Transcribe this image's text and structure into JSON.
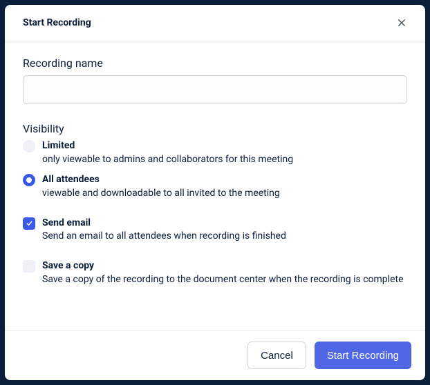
{
  "header": {
    "title": "Start Recording"
  },
  "form": {
    "name_label": "Recording name",
    "name_value": "",
    "visibility_label": "Visibility",
    "options": {
      "limited": {
        "title": "Limited",
        "desc": "only viewable to admins and collaborators for this meeting"
      },
      "all_attendees": {
        "title": "All attendees",
        "desc": "viewable and downloadable to all invited to the meeting"
      },
      "send_email": {
        "title": "Send email",
        "desc": "Send an email to all attendees when recording is finished"
      },
      "save_copy": {
        "title": "Save a copy",
        "desc": "Save a copy of the recording to the document center when the recording is complete"
      }
    }
  },
  "footer": {
    "cancel": "Cancel",
    "submit": "Start Recording"
  }
}
